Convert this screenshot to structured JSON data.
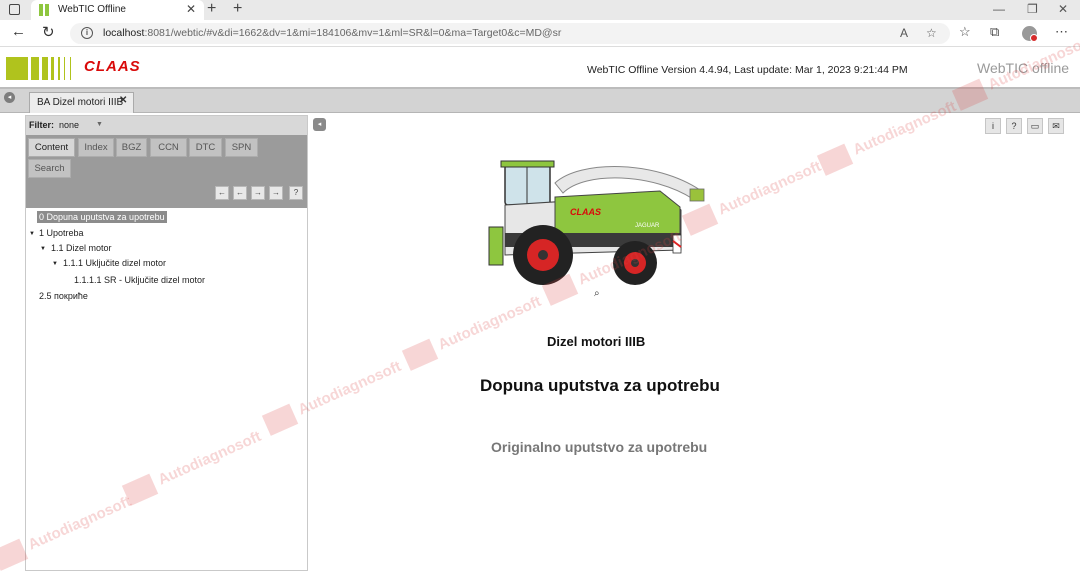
{
  "browser": {
    "tab_title": "WebTIC Offline",
    "url_host": "localhost",
    "url_path": ":8081/webtic/#v&di=1662&dv=1&mi=184106&mv=1&ml=SR&l=0&ma=Target0&c=MD@sr"
  },
  "header": {
    "logo_text": "CLAAS",
    "version_text": "WebTIC Offline Version 4.4.94, Last update: Mar 1, 2023 9:21:44 PM",
    "brand_text": "WebTIC offline"
  },
  "doc_tab": {
    "label": "BA Dizel motori IIIB"
  },
  "filter": {
    "label": "Filter:",
    "value": "none"
  },
  "panel_tabs": [
    "Content",
    "Index",
    "BGZ",
    "CCN",
    "DTC",
    "SPN",
    "Search"
  ],
  "nav_buttons": [
    "←",
    "←",
    "→",
    "→",
    "?"
  ],
  "tree": [
    {
      "label": "0 Dopuna uputstva za upotrebu",
      "selected": true
    },
    {
      "label": "1 Upotreba"
    },
    {
      "label": "1.1 Dizel motor"
    },
    {
      "label": "1.1.1 Uključite dizel motor"
    },
    {
      "label": "1.1.1.1 SR - Uključite dizel motor"
    },
    {
      "label": "2.5 покриће"
    }
  ],
  "content": {
    "title_small": "Dizel motori IIIB",
    "title_main": "Dopuna uputstva za upotrebu",
    "subtitle": "Originalno uputstvo za upotrebu"
  },
  "tools": [
    "i",
    "?",
    "▭",
    "✉"
  ],
  "watermark": "Autodiagnosoft",
  "colors": {
    "claas_green": "#b0c31d",
    "claas_red": "#d90a0a",
    "panel_gray": "#9b9b9b"
  }
}
